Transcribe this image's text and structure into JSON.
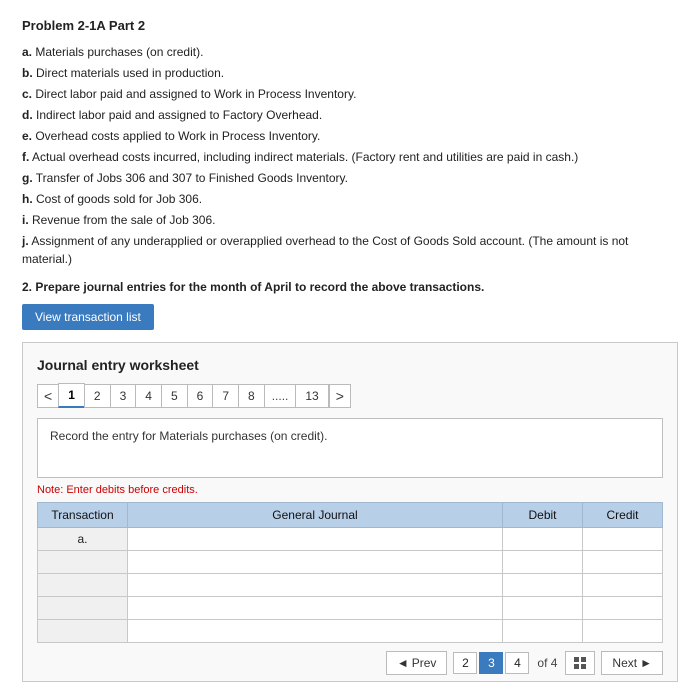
{
  "title": "Problem 2-1A Part 2",
  "instructions": {
    "items": [
      {
        "label": "a.",
        "text": " Materials purchases (on credit)."
      },
      {
        "label": "b.",
        "text": " Direct materials used in production."
      },
      {
        "label": "c.",
        "text": " Direct labor paid and assigned to Work in Process Inventory."
      },
      {
        "label": "d.",
        "text": " Indirect labor paid and assigned to Factory Overhead."
      },
      {
        "label": "e.",
        "text": " Overhead costs applied to Work in Process Inventory."
      },
      {
        "label": "f.",
        "text": " Actual overhead costs incurred, including indirect materials. (Factory rent and utilities are paid in cash.)"
      },
      {
        "label": "g.",
        "text": " Transfer of Jobs 306 and 307 to Finished Goods Inventory."
      },
      {
        "label": "h.",
        "text": " Cost of goods sold for Job 306."
      },
      {
        "label": "i.",
        "text": " Revenue from the sale of Job 306."
      },
      {
        "label": "j.",
        "text": " Assignment of any underapplied or overapplied overhead to the Cost of Goods Sold account. (The amount is not material.)"
      }
    ]
  },
  "section2": {
    "number": "2.",
    "text": "Prepare journal entries for the month of April to record the above transactions."
  },
  "btn_view_transaction": "View transaction list",
  "worksheet": {
    "title": "Journal entry worksheet",
    "tabs": [
      "1",
      "2",
      "3",
      "4",
      "5",
      "6",
      "7",
      "8",
      ".....",
      "13"
    ],
    "active_tab": "1",
    "entry_description": "Record the entry for Materials purchases (on credit).",
    "note": "Note: Enter debits before credits.",
    "table": {
      "headers": [
        "Transaction",
        "General Journal",
        "Debit",
        "Credit"
      ],
      "rows": [
        {
          "transaction": "a.",
          "general_journal": "",
          "debit": "",
          "credit": ""
        },
        {
          "transaction": "",
          "general_journal": "",
          "debit": "",
          "credit": ""
        },
        {
          "transaction": "",
          "general_journal": "",
          "debit": "",
          "credit": ""
        },
        {
          "transaction": "",
          "general_journal": "",
          "debit": "",
          "credit": ""
        },
        {
          "transaction": "",
          "general_journal": "",
          "debit": "",
          "credit": ""
        }
      ]
    }
  },
  "bottom_nav": {
    "prev_label": "Prev",
    "next_label": "Next",
    "pages": [
      "2",
      "3",
      "4"
    ],
    "active_page": "3",
    "of_text": "of 4",
    "prev_arrow": "◄",
    "next_arrow": "►"
  }
}
